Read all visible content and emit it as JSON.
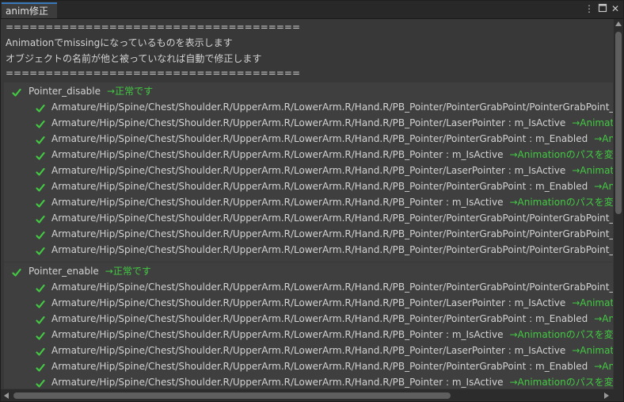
{
  "tab": {
    "title": "anim修正"
  },
  "header": {
    "separator": "=====================================",
    "line1": "Animationでmissingになっているものを表示します",
    "line2": "オブジェクトの名前が他と被っていなれば自動で修正します",
    "separator2": "====================================="
  },
  "sections": [
    {
      "name": "Pointer_disable",
      "status": "→正常です",
      "rows": [
        {
          "path": "Armature/Hip/Spine/Chest/Shoulder.R/UpperArm.R/LowerArm.R/Hand.R/PB_Pointer/PointerGrabPoint/PointerGrabPoint_end : Pc",
          "note": ""
        },
        {
          "path": "Armature/Hip/Spine/Chest/Shoulder.R/UpperArm.R/LowerArm.R/Hand.R/PB_Pointer/LaserPointer : m_IsActive",
          "note": "→Animationのパス"
        },
        {
          "path": "Armature/Hip/Spine/Chest/Shoulder.R/UpperArm.R/LowerArm.R/Hand.R/PB_Pointer/PointerGrabPoint : m_Enabled",
          "note": "→Animation"
        },
        {
          "path": "Armature/Hip/Spine/Chest/Shoulder.R/UpperArm.R/LowerArm.R/Hand.R/PB_Pointer : m_IsActive",
          "note": "→Animationのパスを変更しました"
        },
        {
          "path": "Armature/Hip/Spine/Chest/Shoulder.R/UpperArm.R/LowerArm.R/Hand.R/PB_Pointer/LaserPointer : m_IsActive",
          "note": "→Animationのパス"
        },
        {
          "path": "Armature/Hip/Spine/Chest/Shoulder.R/UpperArm.R/LowerArm.R/Hand.R/PB_Pointer/PointerGrabPoint : m_Enabled",
          "note": "→Animationのパスを"
        },
        {
          "path": "Armature/Hip/Spine/Chest/Shoulder.R/UpperArm.R/LowerArm.R/Hand.R/PB_Pointer : m_IsActive",
          "note": "→Animationのパスを変更しました"
        },
        {
          "path": "Armature/Hip/Spine/Chest/Shoulder.R/UpperArm.R/LowerArm.R/Hand.R/PB_Pointer/PointerGrabPoint/PointerGrabPoint_end : m",
          "note": ""
        },
        {
          "path": "Armature/Hip/Spine/Chest/Shoulder.R/UpperArm.R/LowerArm.R/Hand.R/PB_Pointer/PointerGrabPoint/PointerGrabPoint_end : m",
          "note": ""
        },
        {
          "path": "Armature/Hip/Spine/Chest/Shoulder.R/UpperArm.R/LowerArm.R/Hand.R/PB_Pointer/PointerGrabPoint/PointerGrabPoint_end : m",
          "note": ""
        }
      ]
    },
    {
      "name": "Pointer_enable",
      "status": "→正常です",
      "rows": [
        {
          "path": "Armature/Hip/Spine/Chest/Shoulder.R/UpperArm.R/LowerArm.R/Hand.R/PB_Pointer/PointerGrabPoint/PointerGrabPoint_end : Pc",
          "note": ""
        },
        {
          "path": "Armature/Hip/Spine/Chest/Shoulder.R/UpperArm.R/LowerArm.R/Hand.R/PB_Pointer/LaserPointer : m_IsActive",
          "note": "→Animationのパス"
        },
        {
          "path": "Armature/Hip/Spine/Chest/Shoulder.R/UpperArm.R/LowerArm.R/Hand.R/PB_Pointer/PointerGrabPoint : m_Enabled",
          "note": "→Animation"
        },
        {
          "path": "Armature/Hip/Spine/Chest/Shoulder.R/UpperArm.R/LowerArm.R/Hand.R/PB_Pointer : m_IsActive",
          "note": "→Animationのパスを変更しました"
        },
        {
          "path": "Armature/Hip/Spine/Chest/Shoulder.R/UpperArm.R/LowerArm.R/Hand.R/PB_Pointer/LaserPointer : m_IsActive",
          "note": "→Animationのパス"
        },
        {
          "path": "Armature/Hip/Spine/Chest/Shoulder.R/UpperArm.R/LowerArm.R/Hand.R/PB_Pointer/PointerGrabPoint : m_Enabled",
          "note": "→Animation"
        },
        {
          "path": "Armature/Hip/Spine/Chest/Shoulder.R/UpperArm.R/LowerArm.R/Hand.R/PB_Pointer : m_IsActive",
          "note": "→Animationのパスを変更しました"
        }
      ]
    }
  ],
  "icons": {
    "menu": "kebab-menu-icon",
    "maximize": "maximize-icon",
    "close": "close-icon",
    "check": "check-icon"
  },
  "colors": {
    "ok": "#43c943",
    "tab_accent": "#3a79bb",
    "bg": "#383838"
  }
}
